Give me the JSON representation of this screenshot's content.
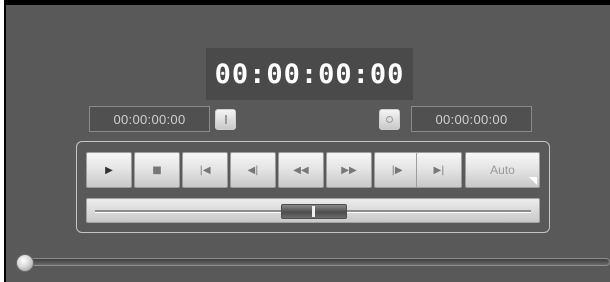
{
  "timecode": {
    "display": "00:00:00:00"
  },
  "mark_in": {
    "value": "00:00:00:00",
    "icon": "mark-in-icon"
  },
  "mark_out": {
    "value": "00:00:00:00",
    "icon": "mark-out-icon"
  },
  "transport": {
    "buttons": [
      {
        "name": "play",
        "glyph": "▶"
      },
      {
        "name": "stop",
        "glyph": "■"
      },
      {
        "name": "home",
        "glyph": "⏮"
      },
      {
        "name": "previous-frame",
        "glyph": "◀|"
      },
      {
        "name": "rewind",
        "glyph": "◀◀"
      },
      {
        "name": "fast-forward",
        "glyph": "▶▶"
      },
      {
        "name": "next-frame",
        "glyph": "|▶"
      },
      {
        "name": "end",
        "glyph": "⏭"
      }
    ],
    "auto_label": "Auto"
  },
  "shuttle": {
    "position": 0.5
  },
  "scrubber": {
    "position": 0
  },
  "colors": {
    "panel_bg": "#595959",
    "timecode_text": "#ffffff",
    "field_text": "#d0d0d0"
  }
}
